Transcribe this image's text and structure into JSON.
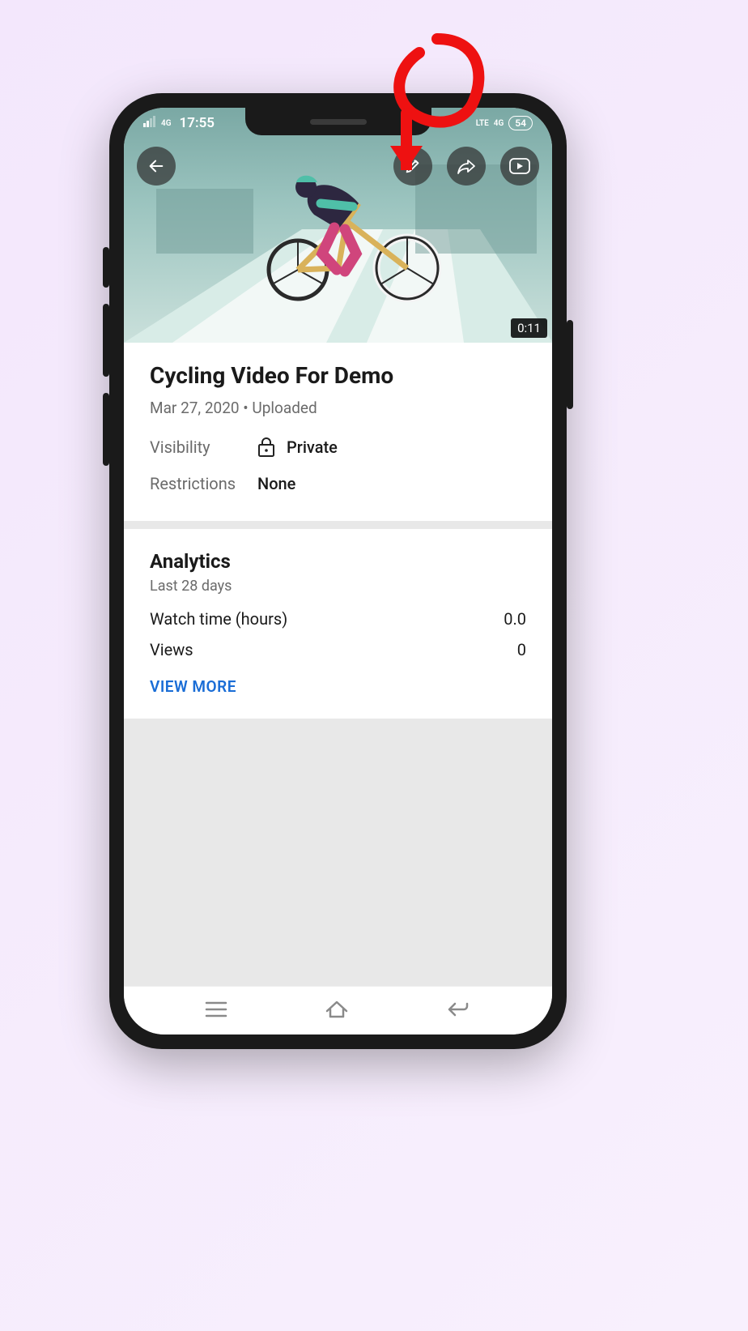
{
  "status": {
    "time": "17:55",
    "signal_left": "4G",
    "carrier": "LTE",
    "signal_right": "4G",
    "battery": "54"
  },
  "video": {
    "duration": "0:11",
    "title": "Cycling Video For Demo",
    "meta": "Mar 27, 2020 • Uploaded",
    "visibility_label": "Visibility",
    "visibility_value": "Private",
    "restrictions_label": "Restrictions",
    "restrictions_value": "None"
  },
  "analytics": {
    "heading": "Analytics",
    "subheading": "Last 28 days",
    "rows": [
      {
        "label": "Watch time (hours)",
        "value": "0.0"
      },
      {
        "label": "Views",
        "value": "0"
      }
    ],
    "view_more": "VIEW MORE"
  },
  "icons": {
    "back": "back-arrow-icon",
    "edit": "pencil-icon",
    "share": "share-arrow-icon",
    "youtube": "youtube-play-icon",
    "lock": "lock-icon"
  }
}
